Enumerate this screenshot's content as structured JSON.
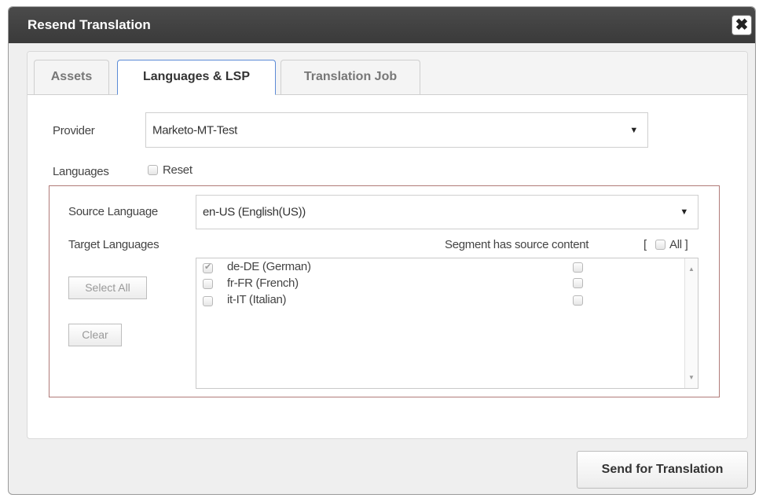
{
  "dialog": {
    "title": "Resend Translation",
    "close_glyph": "✖"
  },
  "tabs": [
    {
      "label": "Assets",
      "active": false
    },
    {
      "label": "Languages & LSP",
      "active": true
    },
    {
      "label": "Translation Job",
      "active": false
    }
  ],
  "provider": {
    "label": "Provider",
    "value": "Marketo-MT-Test"
  },
  "languages": {
    "label": "Languages",
    "reset_label": "Reset",
    "reset_checked": false
  },
  "source_language": {
    "label": "Source Language",
    "value": "en-US  (English(US))"
  },
  "target_languages": {
    "label": "Target Languages",
    "segment_label": "Segment has source content",
    "all_open_bracket": "[",
    "all_label": "All ]",
    "select_all_label": "Select All",
    "clear_label": "Clear",
    "items": [
      {
        "label": "de-DE  (German)",
        "checked": true,
        "segment_checked": false
      },
      {
        "label": "fr-FR  (French)",
        "checked": false,
        "segment_checked": false
      },
      {
        "label": "it-IT  (Italian)",
        "checked": false,
        "segment_checked": false
      }
    ]
  },
  "footer": {
    "send_label": "Send for Translation"
  },
  "icons": {
    "dropdown": "caret-down-icon",
    "close": "close-icon",
    "scroll_up": "scroll-up-icon",
    "scroll_down": "scroll-down-icon"
  },
  "colors": {
    "titlebar": "#3f3f3f",
    "active_tab_border": "#5b8bd6",
    "language_box_border": "#b07a78"
  }
}
